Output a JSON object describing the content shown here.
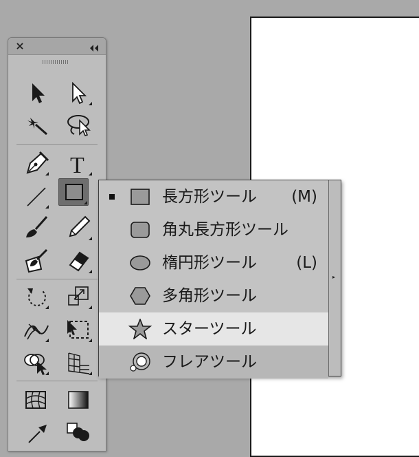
{
  "tools_panel": {
    "close_symbol": "×",
    "collapse_symbol": "◂◂",
    "tools": [
      {
        "name": "selection-tool",
        "icon": "arrow-icon"
      },
      {
        "name": "direct-selection-tool",
        "icon": "hollow-arrow-icon"
      },
      {
        "name": "magic-wand-tool",
        "icon": "magic-wand-icon"
      },
      {
        "name": "lasso-tool",
        "icon": "lasso-icon"
      },
      {
        "name": "pen-tool",
        "icon": "pen-nib-icon"
      },
      {
        "name": "type-tool",
        "icon": "type-icon",
        "glyph": "T"
      },
      {
        "name": "line-segment-tool",
        "icon": "line-icon"
      },
      {
        "name": "rectangle-tool",
        "icon": "rectangle-icon",
        "active": true
      },
      {
        "name": "paintbrush-tool",
        "icon": "brush-icon"
      },
      {
        "name": "pencil-tool",
        "icon": "pencil-icon"
      },
      {
        "name": "blob-brush-tool",
        "icon": "blob-brush-icon"
      },
      {
        "name": "eraser-tool",
        "icon": "eraser-icon"
      },
      {
        "name": "rotate-tool",
        "icon": "rotate-icon"
      },
      {
        "name": "scale-tool",
        "icon": "scale-icon"
      },
      {
        "name": "width-tool",
        "icon": "width-icon"
      },
      {
        "name": "free-transform-tool",
        "icon": "free-transform-icon"
      },
      {
        "name": "shape-builder-tool",
        "icon": "shape-builder-icon"
      },
      {
        "name": "perspective-grid-tool",
        "icon": "perspective-grid-icon"
      },
      {
        "name": "mesh-tool",
        "icon": "mesh-icon"
      },
      {
        "name": "gradient-tool",
        "icon": "gradient-icon"
      },
      {
        "name": "eyedropper-tool",
        "icon": "eyedropper-icon"
      },
      {
        "name": "blend-tool",
        "icon": "blend-icon"
      }
    ]
  },
  "flyout": {
    "tearoff_symbol": "▸",
    "items": [
      {
        "label": "長方形ツール",
        "shortcut": "(M)",
        "icon": "rectangle-icon",
        "checked": true
      },
      {
        "label": "角丸長方形ツール",
        "shortcut": "",
        "icon": "rounded-rectangle-icon",
        "checked": false
      },
      {
        "label": "楕円形ツール",
        "shortcut": "(L)",
        "icon": "ellipse-icon",
        "checked": false
      },
      {
        "label": "多角形ツール",
        "shortcut": "",
        "icon": "polygon-icon",
        "checked": false
      },
      {
        "label": "スターツール",
        "shortcut": "",
        "icon": "star-icon",
        "checked": false,
        "hover": true
      },
      {
        "label": "フレアツール",
        "shortcut": "",
        "icon": "flare-icon",
        "checked": false
      }
    ]
  },
  "colors": {
    "canvas_bg": "#a9a9a9",
    "panel_bg": "#bdbdbd",
    "menu_bg": "#c3c3c3",
    "menu_hover": "#e6e6e6",
    "artboard": "#ffffff"
  }
}
